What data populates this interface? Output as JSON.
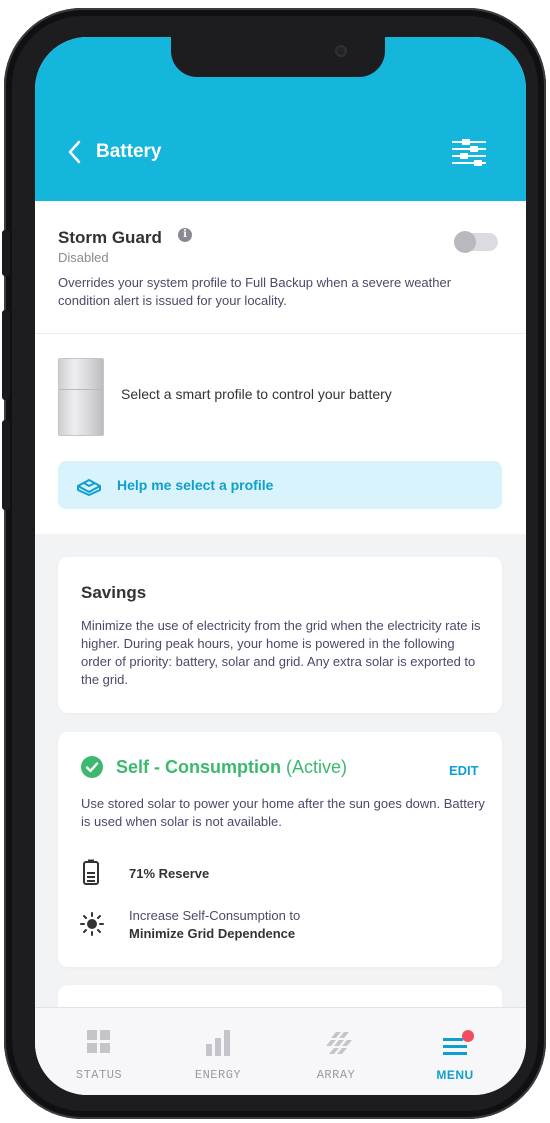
{
  "header": {
    "title": "Battery",
    "back_icon": "chevron-left-icon",
    "filter_icon": "sliders-icon",
    "bg_color": "#15b6dc"
  },
  "storm_guard": {
    "title": "Storm Guard",
    "status": "Disabled",
    "enabled": false,
    "description": "Overrides your system profile to Full Backup when a severe weather condition alert is issued for your locality."
  },
  "profile_select": {
    "prompt": "Select a smart profile to control your battery",
    "help_label": "Help me select a profile"
  },
  "savings": {
    "title": "Savings",
    "description": "Minimize the use of electricity from the grid when the electricity rate is higher. During peak hours, your home is powered in the following order of priority: battery, solar and grid. Any extra solar is exported to the grid."
  },
  "self_consumption": {
    "title": "Self - Consumption",
    "status": "(Active)",
    "edit_label": "EDIT",
    "description": "Use stored solar to power your home after the sun goes down. Battery is used when solar is not available.",
    "reserve_label": "71% Reserve",
    "goal_line1": "Increase Self-Consumption to",
    "goal_line2": "Minimize Grid Dependence",
    "accent_color": "#3cb96e"
  },
  "tabs": [
    {
      "label": "STATUS",
      "icon": "grid-icon",
      "active": false
    },
    {
      "label": "ENERGY",
      "icon": "bar-chart-icon",
      "active": false
    },
    {
      "label": "ARRAY",
      "icon": "solar-array-icon",
      "active": false
    },
    {
      "label": "MENU",
      "icon": "menu-icon",
      "active": true,
      "badge": true
    }
  ]
}
